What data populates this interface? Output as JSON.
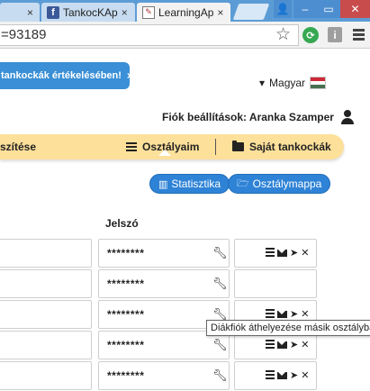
{
  "browser": {
    "tabs": [
      {
        "title": "",
        "active": false
      },
      {
        "title": "TankocKAp",
        "active": false,
        "icon": "facebook-icon"
      },
      {
        "title": "LearningAp",
        "active": true,
        "icon": "document-icon"
      }
    ],
    "tab_close": "×",
    "address": "=93189",
    "window_buttons": {
      "user": "👤",
      "minimize": "–",
      "maximize": "▭",
      "close": "✕"
    },
    "extensions": {
      "green": "⟳",
      "info": "i"
    }
  },
  "page": {
    "notice": {
      "text": "tankockák értékelésében!",
      "close": "×"
    },
    "language": {
      "caret": "▾",
      "label": "Magyar",
      "flag_colors": [
        "#ce2939",
        "#ffffff",
        "#477050"
      ]
    },
    "account": {
      "label": "Fiók beállítások: Aranka Szamper"
    },
    "nav": {
      "item1": "szítése",
      "item2": "Osztályaim",
      "item3": "Saját tankockák"
    },
    "buttons": {
      "stats": "Statisztika",
      "class_folder": "Osztálymappa"
    },
    "table": {
      "password_header": "Jelszó",
      "rows": [
        {
          "password": "********"
        },
        {
          "password": "********"
        },
        {
          "password": "********"
        },
        {
          "password": "********"
        },
        {
          "password": "********"
        }
      ],
      "action_icons": {
        "list": "list-icon",
        "mail": "mail-icon",
        "send": "➤",
        "delete": "✕"
      }
    },
    "tooltip": "Diákfiók áthelyezése másik osztályba"
  },
  "colors": {
    "accent_blue": "#2f83d6",
    "nav_yellow": "#fde09a",
    "notice_blue": "#3a8fd6",
    "titlebar": "#5c9cd6"
  }
}
